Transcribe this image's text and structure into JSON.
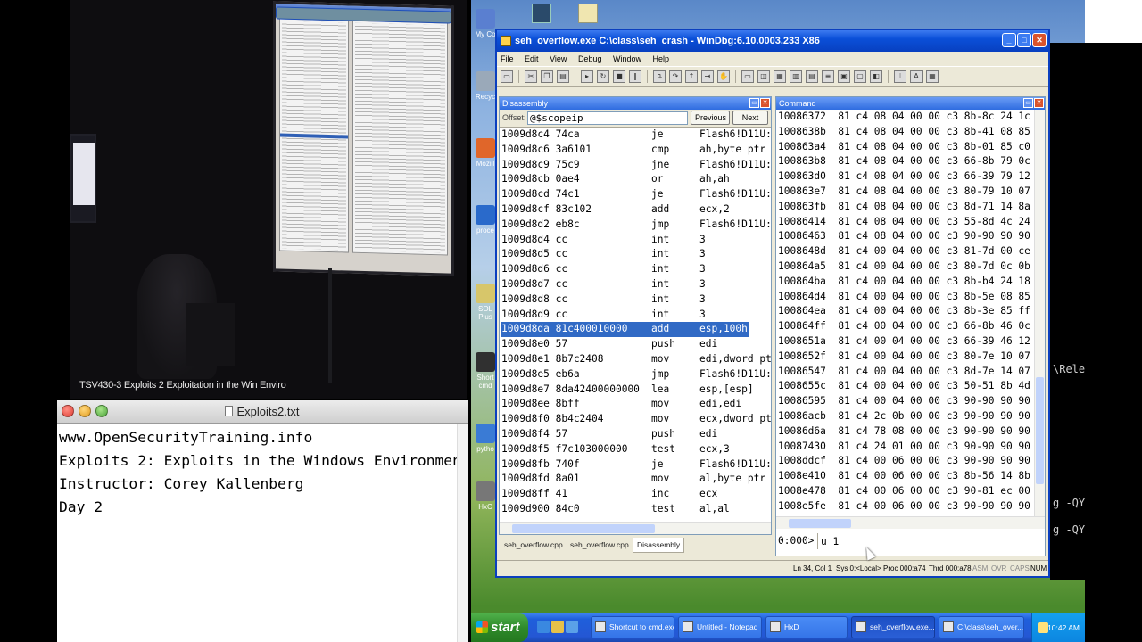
{
  "video": {
    "caption": "TSV430-3 Exploits 2 Exploitation in the Win Enviro"
  },
  "textedit": {
    "title": "Exploits2.txt",
    "lines": [
      "www.OpenSecurityTraining.info",
      "Exploits 2: Exploits in the Windows Environment",
      "Instructor: Corey Kallenberg",
      "Day 2"
    ]
  },
  "desktop": {
    "icons": [
      {
        "label": "My Co",
        "color": "#5a7fd0"
      },
      {
        "label": "Recyc",
        "color": "#9aa9b9"
      },
      {
        "label": "Mozill",
        "color": "#e0662a"
      },
      {
        "label": "proce",
        "color": "#2a6acb"
      },
      {
        "label": "SOL Plus",
        "color": "#d7c66a"
      },
      {
        "label": "Short cmd",
        "color": "#303030"
      },
      {
        "label": "pytho",
        "color": "#3a7bd5"
      },
      {
        "label": "HxC",
        "color": "#777"
      }
    ],
    "console_fragments": [
      "\\Rele",
      "g -QY",
      "g -QY"
    ]
  },
  "windbg": {
    "title": "seh_overflow.exe C:\\class\\seh_crash - WinDbg:6.10.0003.233 X86",
    "menu": [
      "File",
      "Edit",
      "View",
      "Debug",
      "Window",
      "Help"
    ],
    "disassembly": {
      "title": "Disassembly",
      "offset_label": "Offset:",
      "offset_value": "@$scopeip",
      "previous_label": "Previous",
      "next_label": "Next",
      "rows": [
        {
          "addr": "1009d8c4 74ca",
          "mnem": "je",
          "ops": "Flash6!D11U:"
        },
        {
          "addr": "1009d8c6 3a6101",
          "mnem": "cmp",
          "ops": "ah,byte ptr"
        },
        {
          "addr": "1009d8c9 75c9",
          "mnem": "jne",
          "ops": "Flash6!D11U:"
        },
        {
          "addr": "1009d8cb 0ae4",
          "mnem": "or",
          "ops": "ah,ah"
        },
        {
          "addr": "1009d8cd 74c1",
          "mnem": "je",
          "ops": "Flash6!D11U:"
        },
        {
          "addr": "1009d8cf 83c102",
          "mnem": "add",
          "ops": "ecx,2"
        },
        {
          "addr": "1009d8d2 eb8c",
          "mnem": "jmp",
          "ops": "Flash6!D11U:"
        },
        {
          "addr": "1009d8d4 cc",
          "mnem": "int",
          "ops": "3"
        },
        {
          "addr": "1009d8d5 cc",
          "mnem": "int",
          "ops": "3"
        },
        {
          "addr": "1009d8d6 cc",
          "mnem": "int",
          "ops": "3"
        },
        {
          "addr": "1009d8d7 cc",
          "mnem": "int",
          "ops": "3"
        },
        {
          "addr": "1009d8d8 cc",
          "mnem": "int",
          "ops": "3"
        },
        {
          "addr": "1009d8d9 cc",
          "mnem": "int",
          "ops": "3"
        },
        {
          "addr": "1009d8da 81c400010000",
          "mnem": "add",
          "ops": "esp,100h",
          "selected": true
        },
        {
          "addr": "1009d8e0 57",
          "mnem": "push",
          "ops": "edi"
        },
        {
          "addr": "1009d8e1 8b7c2408",
          "mnem": "mov",
          "ops": "edi,dword pt"
        },
        {
          "addr": "1009d8e5 eb6a",
          "mnem": "jmp",
          "ops": "Flash6!D11U:"
        },
        {
          "addr": "1009d8e7 8da42400000000",
          "mnem": "lea",
          "ops": "esp,[esp]"
        },
        {
          "addr": "1009d8ee 8bff",
          "mnem": "mov",
          "ops": "edi,edi"
        },
        {
          "addr": "1009d8f0 8b4c2404",
          "mnem": "mov",
          "ops": "ecx,dword pt"
        },
        {
          "addr": "1009d8f4 57",
          "mnem": "push",
          "ops": "edi"
        },
        {
          "addr": "1009d8f5 f7c103000000",
          "mnem": "test",
          "ops": "ecx,3"
        },
        {
          "addr": "1009d8fb 740f",
          "mnem": "je",
          "ops": "Flash6!D11U:"
        },
        {
          "addr": "1009d8fd 8a01",
          "mnem": "mov",
          "ops": "al,byte ptr"
        },
        {
          "addr": "1009d8ff 41",
          "mnem": "inc",
          "ops": "ecx"
        },
        {
          "addr": "1009d900 84c0",
          "mnem": "test",
          "ops": "al,al"
        }
      ]
    },
    "command": {
      "title": "Command",
      "rows": [
        "10086372  81 c4 08 04 00 00 c3 8b-8c 24 1c",
        "1008638b  81 c4 08 04 00 00 c3 8b-41 08 85",
        "100863a4  81 c4 08 04 00 00 c3 8b-01 85 c0",
        "100863b8  81 c4 08 04 00 00 c3 66-8b 79 0c",
        "100863d0  81 c4 08 04 00 00 c3 66-39 79 12",
        "100863e7  81 c4 08 04 00 00 c3 80-79 10 07",
        "100863fb  81 c4 08 04 00 00 c3 8d-71 14 8a",
        "10086414  81 c4 08 04 00 00 c3 55-8d 4c 24",
        "10086463  81 c4 08 04 00 00 c3 90-90 90 90",
        "1008648d  81 c4 00 04 00 00 c3 81-7d 00 ce",
        "100864a5  81 c4 00 04 00 00 c3 80-7d 0c 0b",
        "100864ba  81 c4 00 04 00 00 c3 8b-b4 24 18",
        "100864d4  81 c4 00 04 00 00 c3 8b-5e 08 85",
        "100864ea  81 c4 00 04 00 00 c3 8b-3e 85 ff",
        "100864ff  81 c4 00 04 00 00 c3 66-8b 46 0c",
        "1008651a  81 c4 00 04 00 00 c3 66-39 46 12",
        "1008652f  81 c4 00 04 00 00 c3 80-7e 10 07",
        "10086547  81 c4 00 04 00 00 c3 8d-7e 14 07",
        "1008655c  81 c4 00 04 00 00 c3 50-51 8b 4d",
        "10086595  81 c4 00 04 00 00 c3 90-90 90 90",
        "10086acb  81 c4 2c 0b 00 00 c3 90-90 90 90",
        "10086d6a  81 c4 78 08 00 00 c3 90-90 90 90",
        "10087430  81 c4 24 01 00 00 c3 90-90 90 90",
        "1008ddcf  81 c4 00 06 00 00 c3 90-90 90 90",
        "1008e410  81 c4 00 06 00 00 c3 8b-56 14 8b",
        "1008e478  81 c4 00 06 00 00 c3 90-81 ec 00",
        "1008e5fe  81 c4 00 06 00 00 c3 90-90 90 90"
      ],
      "prompt": "0:000>",
      "input_value": "u 1"
    },
    "tabs": [
      "seh_overflow.cpp",
      "seh_overflow.cpp",
      "Disassembly"
    ],
    "status": {
      "position": "Ln 34, Col 1",
      "sys": "Sys 0:<Local>",
      "proc": "Proc 000:a74",
      "thrd": "Thrd 000:a78",
      "asm": "ASM",
      "ovr": "OVR",
      "caps": "CAPS",
      "num": "NUM"
    }
  },
  "taskbar": {
    "start_label": "start",
    "tasks": [
      {
        "label": "Shortcut to cmd.exe",
        "active": false
      },
      {
        "label": "Untitled - Notepad",
        "active": false
      },
      {
        "label": "HxD",
        "active": false
      },
      {
        "label": "seh_overflow.exe...",
        "active": true
      },
      {
        "label": "C:\\class\\seh_over...",
        "active": false
      }
    ],
    "clock": "10:42 AM"
  }
}
